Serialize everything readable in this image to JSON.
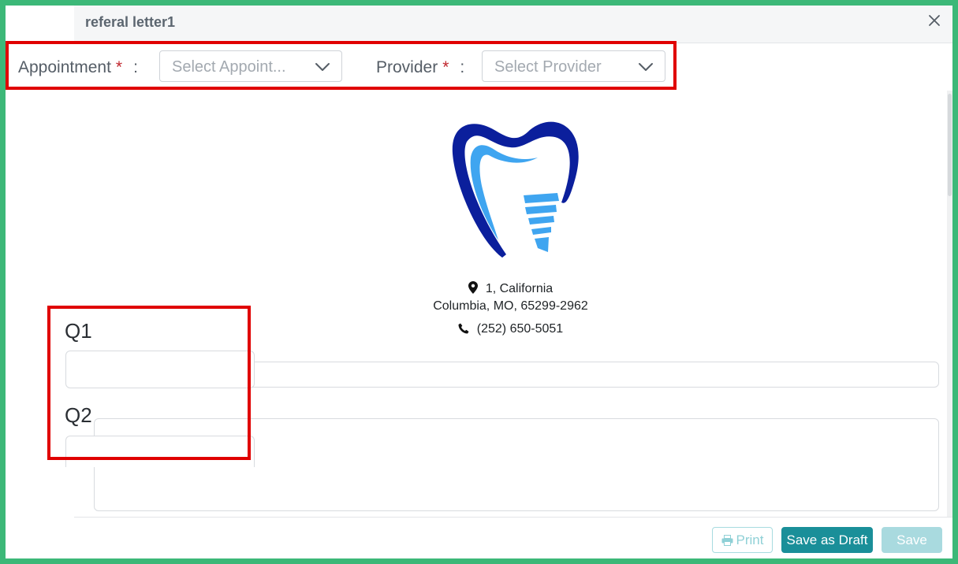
{
  "modal": {
    "title": "referal letter1"
  },
  "selectors": {
    "appointment": {
      "label": "Appointment",
      "required_mark": "*",
      "colon": ":",
      "placeholder": "Select Appoint..."
    },
    "provider": {
      "label": "Provider",
      "required_mark": "*",
      "colon": ":",
      "placeholder": "Select Provider"
    }
  },
  "letterhead": {
    "address_line1": "1, California",
    "address_line2": "Columbia, MO, 65299-2962",
    "phone": "(252) 650-5051"
  },
  "questions": [
    {
      "label": "Q1",
      "value": ""
    },
    {
      "label": "Q2",
      "value": ""
    }
  ],
  "footer": {
    "print_label": "Print",
    "save_draft_label": "Save as Draft",
    "save_label": "Save"
  },
  "colors": {
    "outer_border": "#3cb878",
    "highlight": "#e00000",
    "primary_button": "#1a8f99",
    "logo_dark": "#0b1f9c",
    "logo_light": "#3fa5f0"
  },
  "icons": {
    "close": "close-icon",
    "chevron": "chevron-down-icon",
    "location": "map-pin-icon",
    "phone": "phone-icon",
    "print": "printer-icon"
  }
}
